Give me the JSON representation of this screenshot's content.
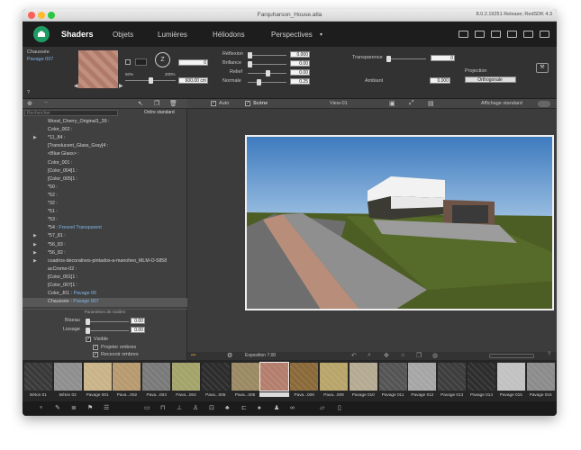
{
  "window": {
    "title": "Farquharson_House.atla",
    "version": "8.0.2.19251 Release; RedSDK 4.3"
  },
  "nav": {
    "tabs": [
      "Shaders",
      "Objets",
      "Lumières",
      "Héliodons",
      "Perspectives"
    ],
    "active": 0
  },
  "shader": {
    "category": "Chaussée",
    "name": "Pavage 007",
    "scale_left": "50%",
    "scale_right": "200%",
    "field_top": "0",
    "size_value": "600.00 cm",
    "help": "?"
  },
  "properties": [
    {
      "label": "Réflexion",
      "value": "0.000",
      "level": 0.0
    },
    {
      "label": "Brillance",
      "value": "0.00",
      "level": 0.0
    },
    {
      "label": "Relief",
      "value": "0.00",
      "level": 0.5
    },
    {
      "label": "Normale",
      "value": "0.25",
      "level": 0.25
    }
  ],
  "transparence": {
    "label": "Transparence",
    "value": "0"
  },
  "ambiant": {
    "label": "Ambiant",
    "value": "0.000"
  },
  "projection": {
    "label": "Projection",
    "value": "Orthogonale"
  },
  "left_panel": {
    "search_placeholder": "Rechercher",
    "sort": "Ordre standard",
    "params_title": "Paramètres de matière",
    "biseau_label": "Biseau",
    "biseau_value": "0.00",
    "lissage_label": "Lissage",
    "lissage_value": "0.00",
    "visible_label": "Visible",
    "projeter_label": "Projeter ombres",
    "recevoir_label": "Recevoir ombres"
  },
  "materials_list": [
    {
      "name": "Wood_Cherry_Original1_39 :",
      "sub": "",
      "exp": false
    },
    {
      "name": "Color_002 :",
      "sub": "",
      "exp": false
    },
    {
      "name": "*11_84 :",
      "sub": "",
      "exp": true
    },
    {
      "name": "[Translucent_Glass_Gray]4 :",
      "sub": "",
      "exp": false
    },
    {
      "name": "<Blue Glass> :",
      "sub": "",
      "exp": false
    },
    {
      "name": "Color_001 :",
      "sub": "",
      "exp": false
    },
    {
      "name": "[Color_004]1 :",
      "sub": "",
      "exp": false
    },
    {
      "name": "[Color_005]1 :",
      "sub": "",
      "exp": false
    },
    {
      "name": "*50 :",
      "sub": "",
      "exp": false
    },
    {
      "name": "*52 :",
      "sub": "",
      "exp": false
    },
    {
      "name": "*32 :",
      "sub": "",
      "exp": false
    },
    {
      "name": "*51 :",
      "sub": "",
      "exp": false
    },
    {
      "name": "*53 :",
      "sub": "",
      "exp": false
    },
    {
      "name": "*54 :",
      "sub": "Fresnel Transparent",
      "exp": false
    },
    {
      "name": "*57_81 :",
      "sub": "",
      "exp": true
    },
    {
      "name": "*56_83 :",
      "sub": "",
      "exp": true
    },
    {
      "name": "*56_82 :",
      "sub": "",
      "exp": true
    },
    {
      "name": "cuadros-decorativos-pintados-a-manoheo_MLM-O-5858",
      "sub": "",
      "exp": true
    },
    {
      "name": "acCromo-02 :",
      "sub": "",
      "exp": false
    },
    {
      "name": "[Color_001]1 :",
      "sub": "",
      "exp": false
    },
    {
      "name": "[Color_007]1 :",
      "sub": "",
      "exp": false
    },
    {
      "name": "Color_J01 :",
      "sub": "Pavage 06",
      "exp": false
    },
    {
      "name": "Chaussée :",
      "sub": "Pavage 007",
      "exp": false,
      "selected": true
    }
  ],
  "viewport": {
    "auto_label": "Auto",
    "scene_label": "Scène",
    "view_name": "View-01",
    "display_label": "Affichage standard",
    "exposure": "Exposition 7.00"
  },
  "tiles": [
    {
      "label": "Béton 01",
      "color": "#3a3a3a"
    },
    {
      "label": "Béton 02",
      "color": "#8f8f8f"
    },
    {
      "label": "Pavage 001",
      "color": "#c9b48a"
    },
    {
      "label": "Pava...002",
      "color": "#b79a6f"
    },
    {
      "label": "Pava...003",
      "color": "#7a7a7a"
    },
    {
      "label": "Pava...004",
      "color": "#a3a36a"
    },
    {
      "label": "Pava...005",
      "color": "#2d2d2d"
    },
    {
      "label": "Pava...006",
      "color": "#9b8a63"
    },
    {
      "label": "Pavage 007",
      "color": "#b47e6d"
    },
    {
      "label": "Pava...008",
      "color": "#8a6a3a"
    },
    {
      "label": "Pava...009",
      "color": "#b8a56a"
    },
    {
      "label": "Pavage 010",
      "color": "#b5ab93"
    },
    {
      "label": "Pavage 011",
      "color": "#555555"
    },
    {
      "label": "Pavage 012",
      "color": "#a6a6a6"
    },
    {
      "label": "Pavage 013",
      "color": "#3e3e3e"
    },
    {
      "label": "Pavage 014",
      "color": "#2e2e2e"
    },
    {
      "label": "Pavage 015",
      "color": "#c2c2c2"
    },
    {
      "label": "Pavage 016",
      "color": "#8c8c8c"
    }
  ],
  "colors": {
    "accent": "#1f9b64",
    "highlight": "#7fb6e8"
  }
}
